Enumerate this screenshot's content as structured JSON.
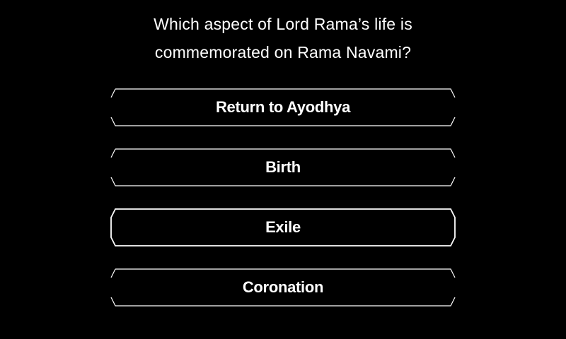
{
  "question": {
    "line1": "Which aspect of Lord Rama’s life is",
    "line2": "commemorated on Rama Navami?"
  },
  "answers": [
    {
      "label": "Return to Ayodhya",
      "selected": false
    },
    {
      "label": "Birth",
      "selected": false
    },
    {
      "label": "Exile",
      "selected": true
    },
    {
      "label": "Coronation",
      "selected": false
    }
  ],
  "colors": {
    "background": "#000000",
    "text": "#ffffff",
    "frame": "#ffffff"
  }
}
